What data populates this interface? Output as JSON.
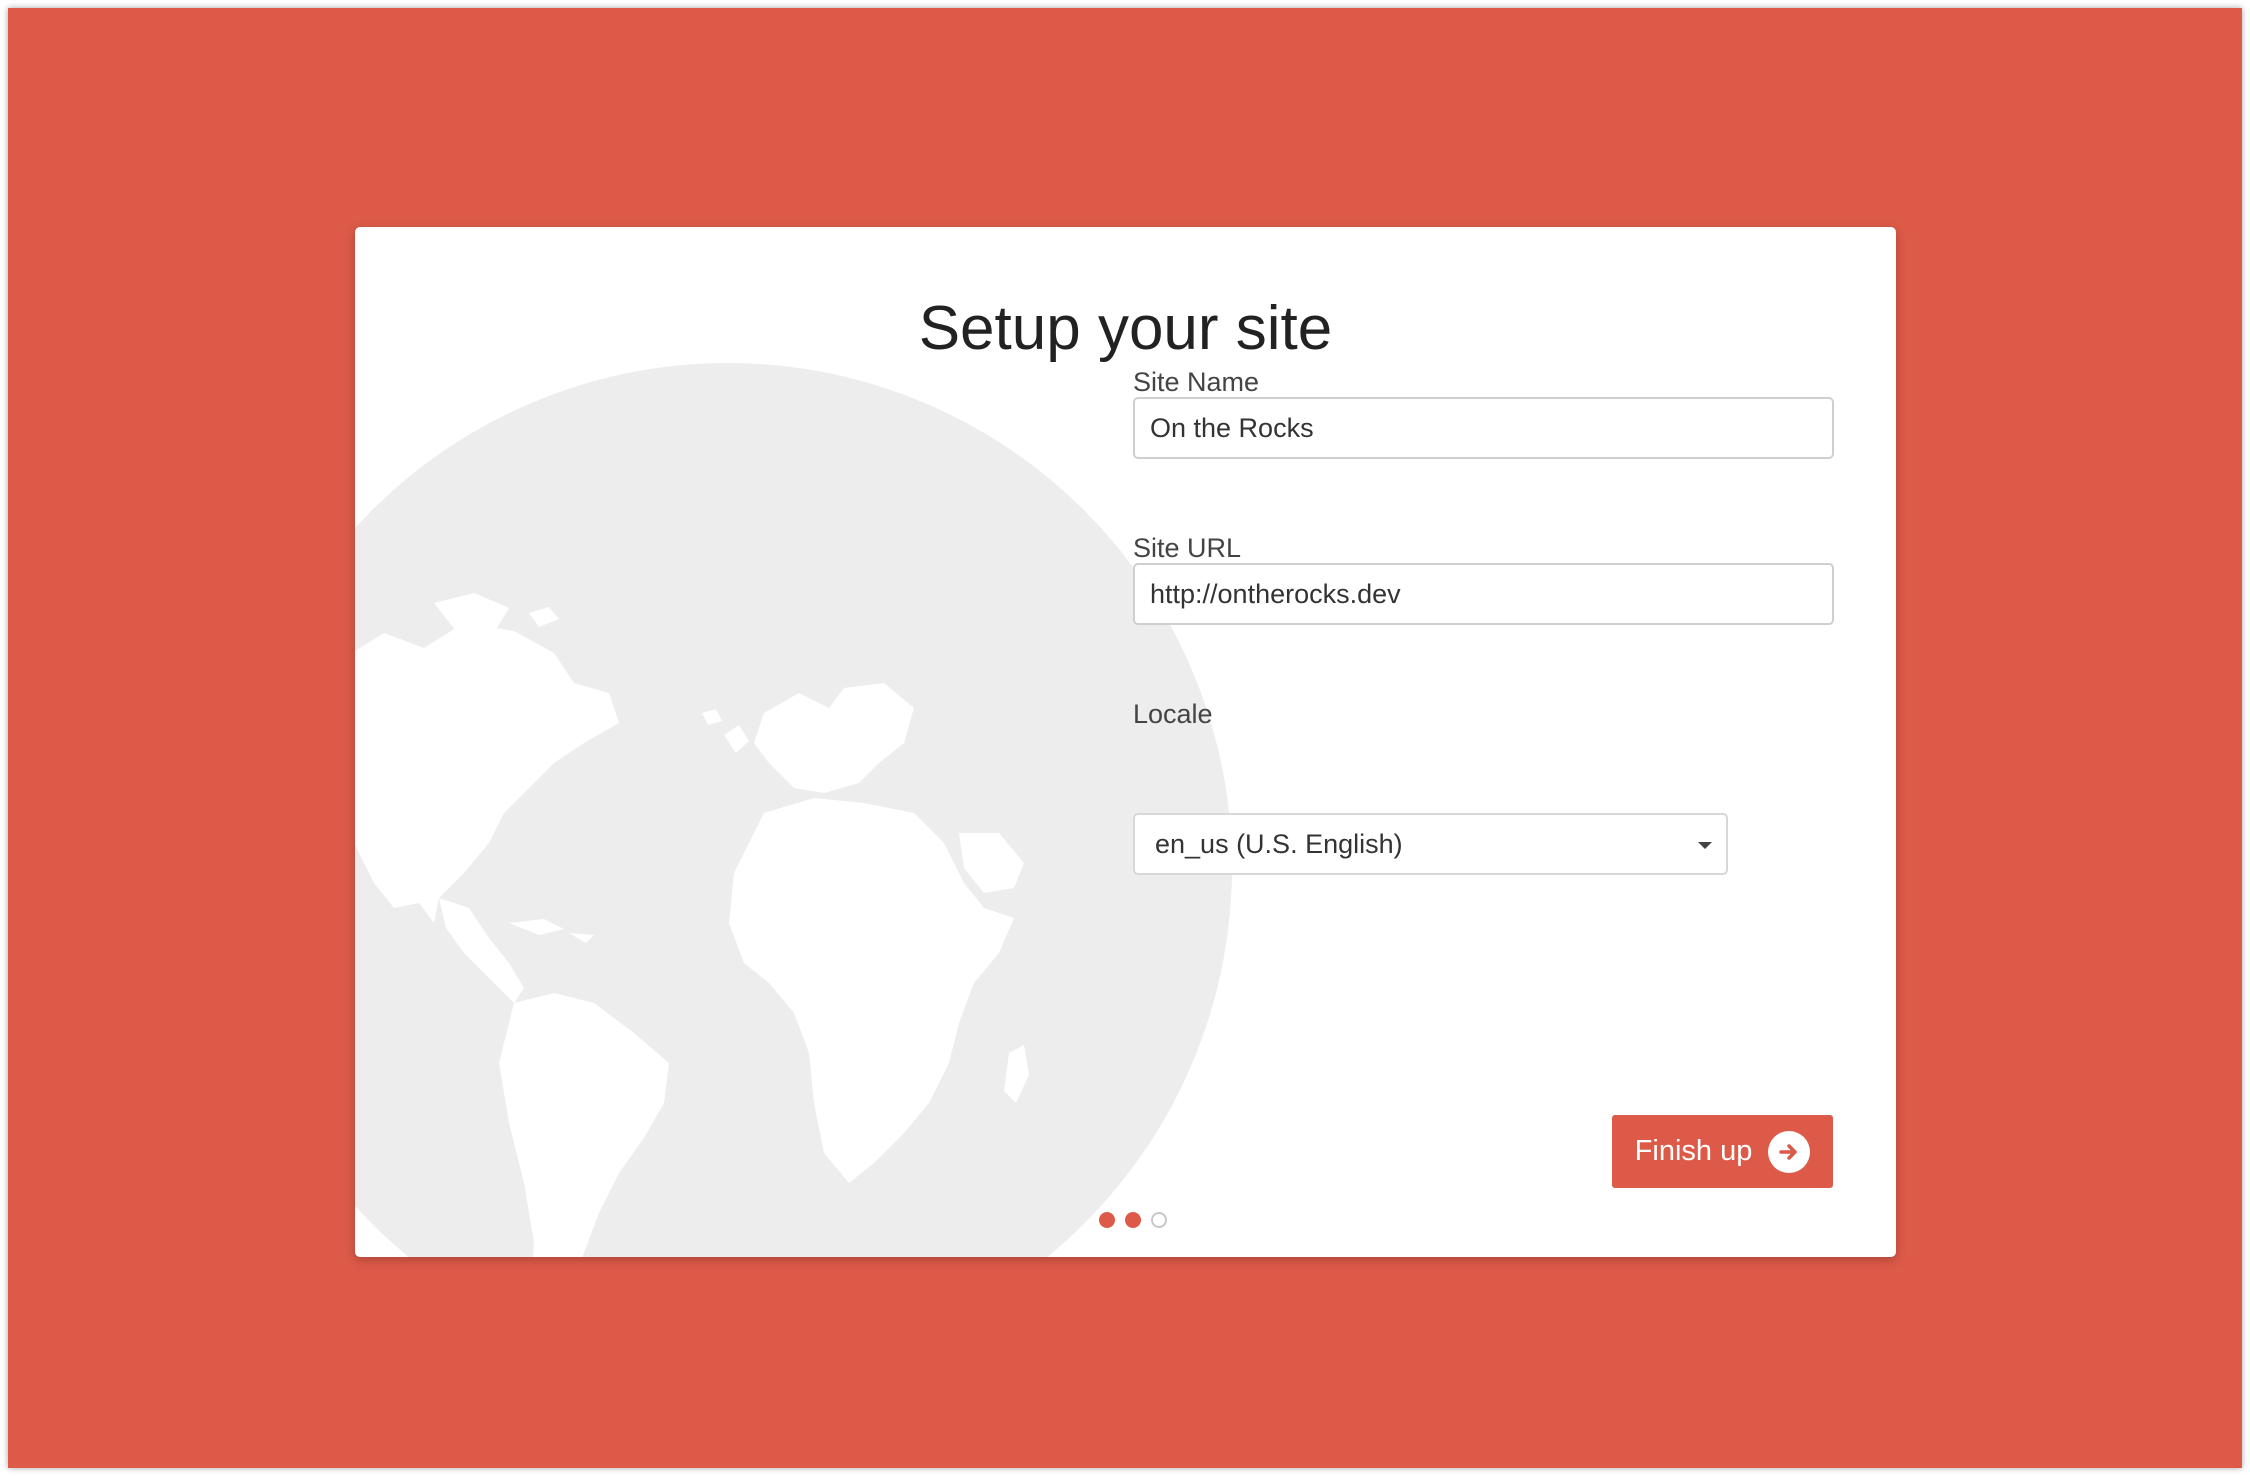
{
  "page": {
    "title": "Setup your site"
  },
  "form": {
    "site_name": {
      "label": "Site Name",
      "value": "On the Rocks"
    },
    "site_url": {
      "label": "Site URL",
      "value": "http://ontherocks.dev"
    },
    "locale": {
      "label": "Locale",
      "value": "en_us (U.S. English)"
    }
  },
  "actions": {
    "finish_label": "Finish up"
  },
  "progress": {
    "current_step": 2,
    "total_steps": 3
  },
  "colors": {
    "accent": "#dc5a47",
    "card": "#ffffff",
    "globe": "#ededed"
  },
  "icons": {
    "finish": "arrow-right-circle-icon",
    "dropdown": "caret-down-icon",
    "background": "world-map-globe"
  }
}
